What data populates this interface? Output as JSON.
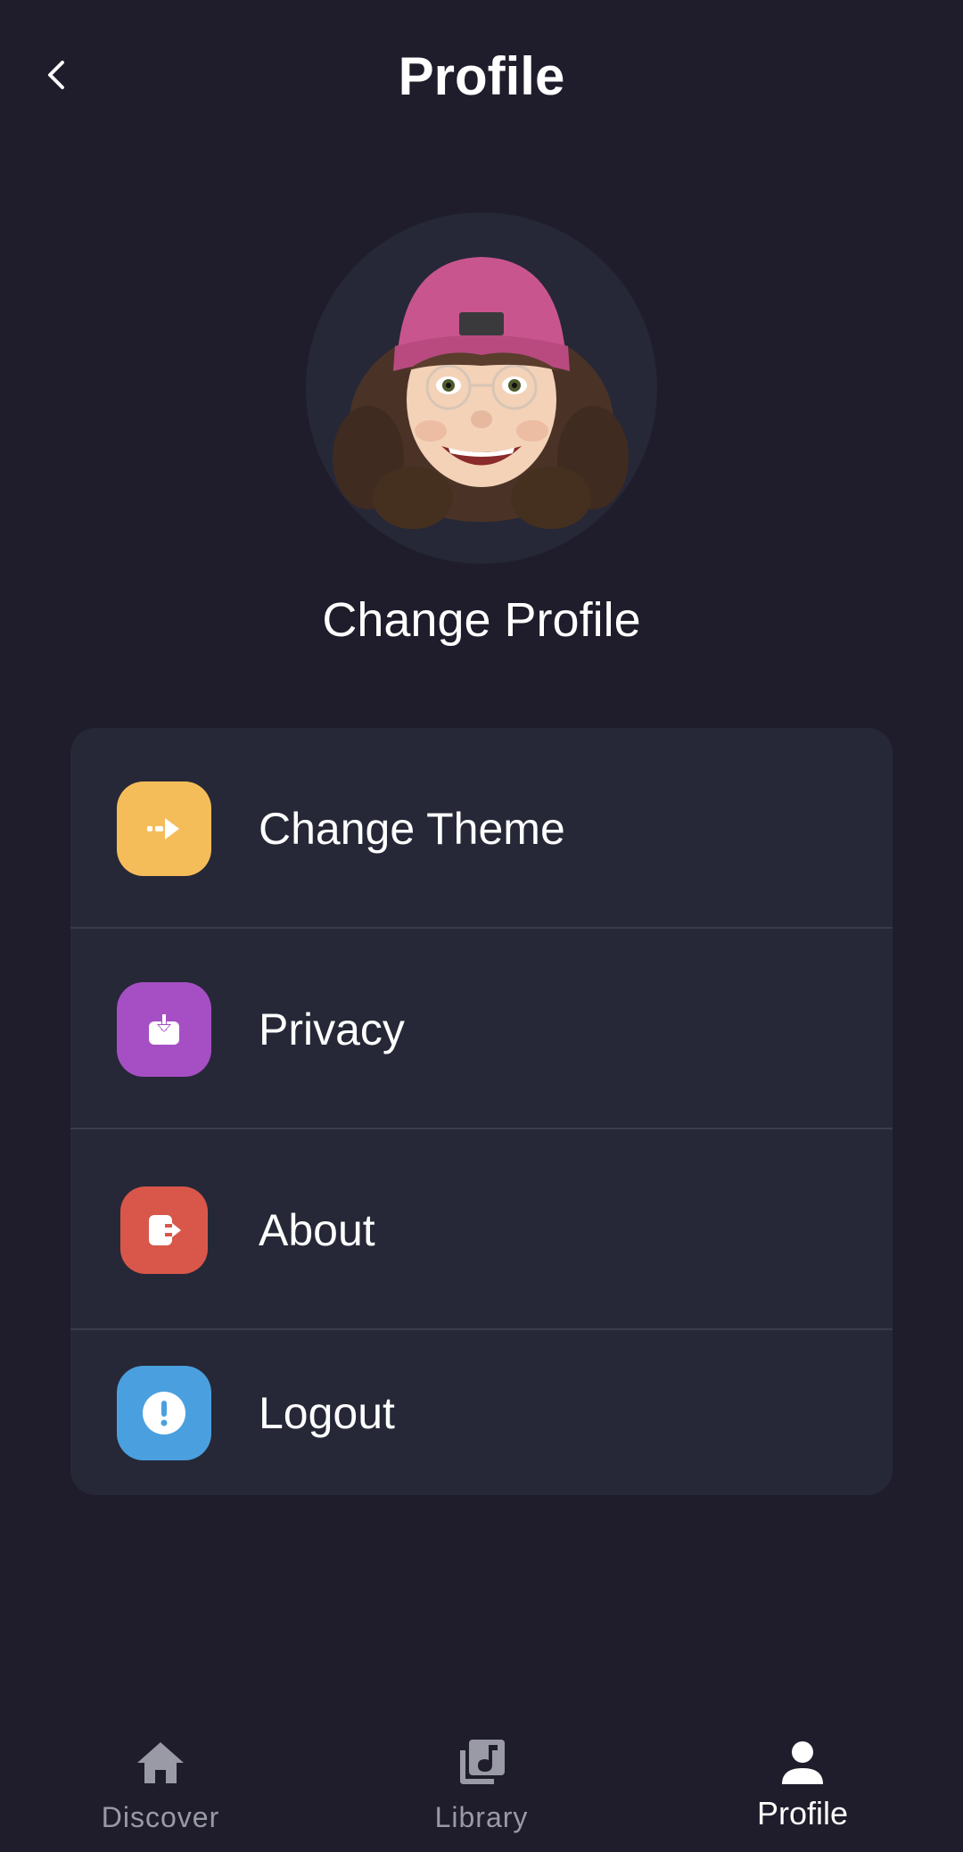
{
  "header": {
    "title": "Profile",
    "back_icon": "chevron-left-icon"
  },
  "profile": {
    "avatar_icon": "memoji-avatar",
    "change_label": "Change Profile"
  },
  "menu": {
    "items": [
      {
        "label": "Change Theme",
        "icon": "theme-icon",
        "color": "#f5bd5a"
      },
      {
        "label": "Privacy",
        "icon": "download-box-icon",
        "color": "#a64fc4"
      },
      {
        "label": "About",
        "icon": "exit-icon",
        "color": "#d9574a"
      },
      {
        "label": "Logout",
        "icon": "alert-icon",
        "color": "#4aa0de"
      }
    ]
  },
  "bottom_nav": {
    "items": [
      {
        "label": "Discover",
        "icon": "home-icon",
        "active": false
      },
      {
        "label": "Library",
        "icon": "music-library-icon",
        "active": false
      },
      {
        "label": "Profile",
        "icon": "person-icon",
        "active": true
      }
    ]
  },
  "colors": {
    "background": "#1f1d2b",
    "card": "#262837",
    "divider": "#3a3c4b",
    "inactive_text": "#9a9aa6",
    "active_text": "#ffffff"
  }
}
